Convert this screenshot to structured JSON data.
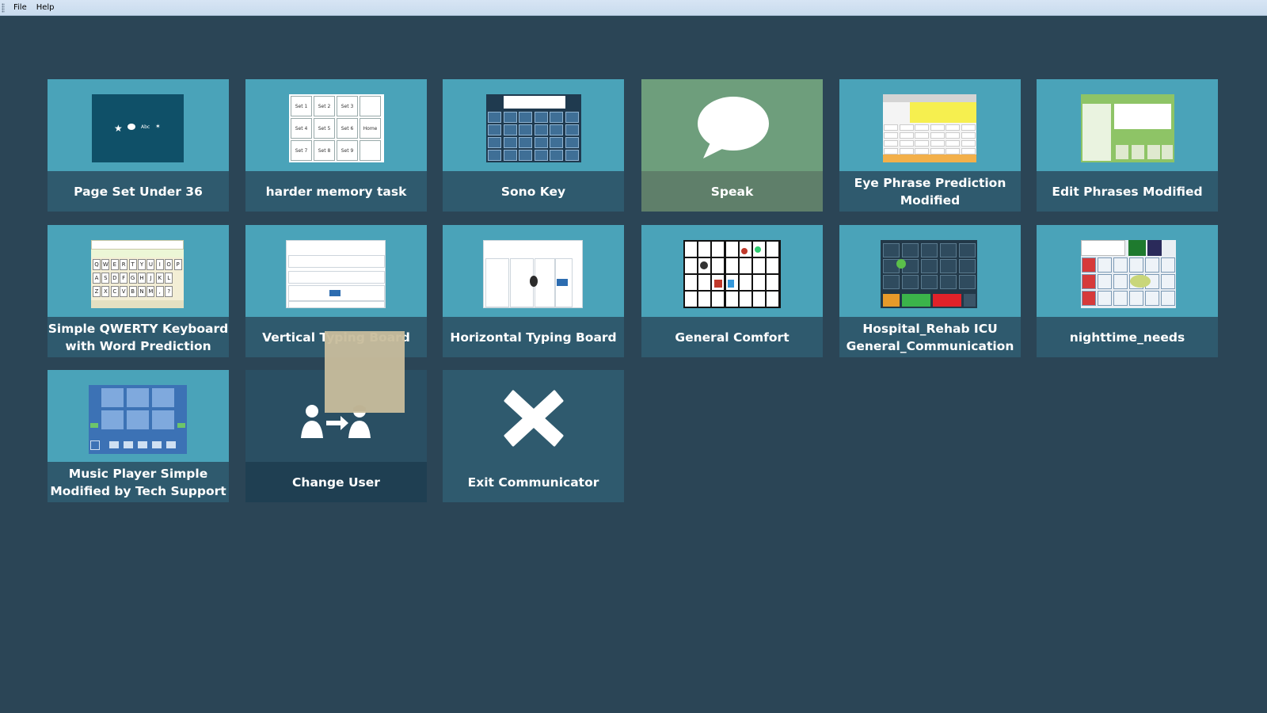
{
  "menubar": {
    "items": [
      "File",
      "Help"
    ]
  },
  "tiles": [
    {
      "label": "Page Set Under 36",
      "icon": "page-set-thumbnail"
    },
    {
      "label": "harder memory task",
      "icon": "memory-grid-thumbnail",
      "grid_labels": [
        "Set 1",
        "Set 2",
        "Set 3",
        "",
        "Set 4",
        "Set 5",
        "Set 6",
        "Home",
        "Set 7",
        "Set 8",
        "Set 9",
        ""
      ]
    },
    {
      "label": "Sono Key",
      "icon": "sono-key-thumbnail"
    },
    {
      "label": "Speak",
      "icon": "speech-bubble-icon"
    },
    {
      "label": "Eye Phrase Prediction Modified",
      "icon": "eye-phrase-thumbnail"
    },
    {
      "label": "Edit Phrases Modified",
      "icon": "edit-phrases-thumbnail"
    },
    {
      "label": "Simple QWERTY Keyboard with Word Prediction",
      "icon": "qwerty-keyboard-thumbnail",
      "keys": [
        "Q",
        "W",
        "E",
        "R",
        "T",
        "Y",
        "U",
        "I",
        "O",
        "P",
        "A",
        "S",
        "D",
        "F",
        "G",
        "H",
        "J",
        "K",
        "L",
        "Z",
        "X",
        "C",
        "V",
        "B",
        "N",
        "M",
        ",",
        "?"
      ]
    },
    {
      "label": "Vertical Typing Board",
      "icon": "vertical-typing-thumbnail"
    },
    {
      "label": "Horizontal Typing Board",
      "icon": "horizontal-typing-thumbnail"
    },
    {
      "label": "General Comfort",
      "icon": "general-comfort-thumbnail"
    },
    {
      "label": "Hospital_Rehab ICU General_Communication",
      "icon": "hospital-rehab-thumbnail"
    },
    {
      "label": "nighttime_needs",
      "icon": "nighttime-needs-thumbnail"
    },
    {
      "label": "Music Player Simple Modified by Tech Support",
      "icon": "music-player-thumbnail"
    },
    {
      "label": "Change User",
      "icon": "change-user-icon"
    },
    {
      "label": "Exit Communicator",
      "icon": "close-icon"
    }
  ],
  "colors": {
    "background": "#2b4556",
    "tile_top": "#4aa3b9",
    "tile_label": "#2f5a6e",
    "speak_tile": "#6e9e7c"
  }
}
